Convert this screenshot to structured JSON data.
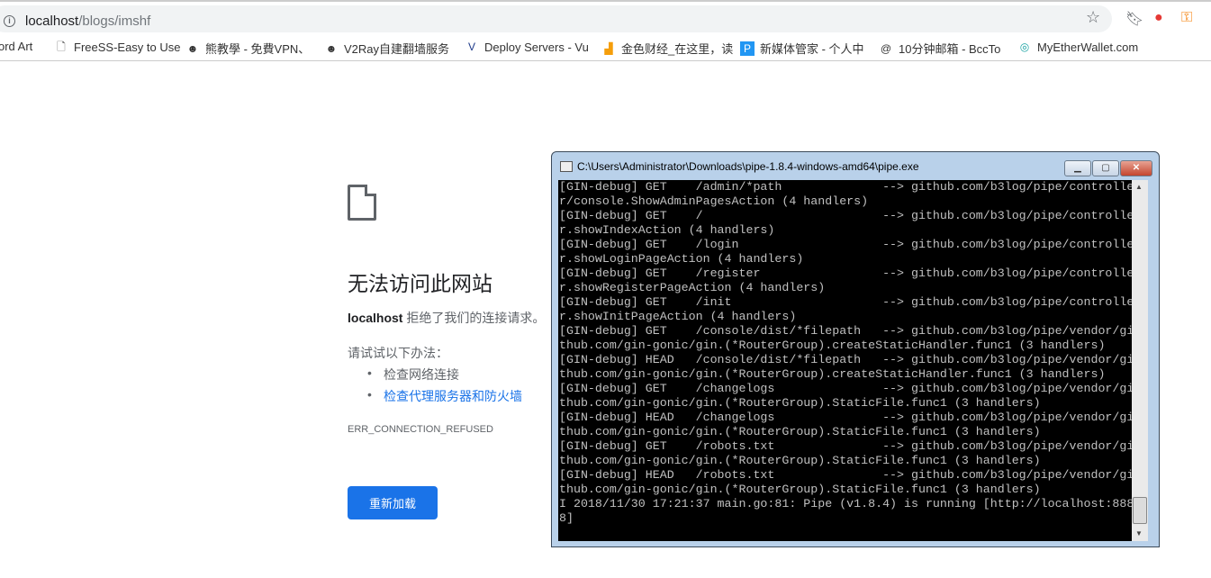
{
  "browser": {
    "url_host": "localhost",
    "url_path": "/blogs/imshf",
    "bookmarks": [
      {
        "label": "ord Art",
        "icon": ""
      },
      {
        "label": "FreeSS-Easy to Use",
        "icon": "page-icon"
      },
      {
        "label": "熊教學 - 免費VPN、",
        "icon": "avatar-icon"
      },
      {
        "label": "V2Ray自建翻墙服务",
        "icon": "avatar-icon"
      },
      {
        "label": "Deploy Servers - Vu",
        "icon": "vultr-icon"
      },
      {
        "label": "金色财经_在这里，读",
        "icon": "jinse-icon"
      },
      {
        "label": "新媒体管家 - 个人中",
        "icon": "p-icon"
      },
      {
        "label": "10分钟邮箱 - BccTo",
        "icon": "at-icon"
      },
      {
        "label": "MyEtherWallet.com",
        "icon": "mew-icon"
      }
    ]
  },
  "error_page": {
    "title": "无法访问此网站",
    "host": "localhost",
    "message": " 拒绝了我们的连接请求。",
    "try": "请试试以下办法：",
    "suggestions": [
      "检查网络连接",
      "检查代理服务器和防火墙"
    ],
    "code": "ERR_CONNECTION_REFUSED",
    "reload": "重新加载",
    "link_color": "#1a73e8"
  },
  "console": {
    "title": "C:\\Users\\Administrator\\Downloads\\pipe-1.8.4-windows-amd64\\pipe.exe",
    "lines": [
      "[GIN-debug] GET    /admin/*path              --> github.com/b3log/pipe/controlle",
      "r/console.ShowAdminPagesAction (4 handlers)",
      "[GIN-debug] GET    /                         --> github.com/b3log/pipe/controlle",
      "r.showIndexAction (4 handlers)",
      "[GIN-debug] GET    /login                    --> github.com/b3log/pipe/controlle",
      "r.showLoginPageAction (4 handlers)",
      "[GIN-debug] GET    /register                 --> github.com/b3log/pipe/controlle",
      "r.showRegisterPageAction (4 handlers)",
      "[GIN-debug] GET    /init                     --> github.com/b3log/pipe/controlle",
      "r.showInitPageAction (4 handlers)",
      "[GIN-debug] GET    /console/dist/*filepath   --> github.com/b3log/pipe/vendor/gi",
      "thub.com/gin-gonic/gin.(*RouterGroup).createStaticHandler.func1 (3 handlers)",
      "[GIN-debug] HEAD   /console/dist/*filepath   --> github.com/b3log/pipe/vendor/gi",
      "thub.com/gin-gonic/gin.(*RouterGroup).createStaticHandler.func1 (3 handlers)",
      "[GIN-debug] GET    /changelogs               --> github.com/b3log/pipe/vendor/gi",
      "thub.com/gin-gonic/gin.(*RouterGroup).StaticFile.func1 (3 handlers)",
      "[GIN-debug] HEAD   /changelogs               --> github.com/b3log/pipe/vendor/gi",
      "thub.com/gin-gonic/gin.(*RouterGroup).StaticFile.func1 (3 handlers)",
      "[GIN-debug] GET    /robots.txt               --> github.com/b3log/pipe/vendor/gi",
      "thub.com/gin-gonic/gin.(*RouterGroup).StaticFile.func1 (3 handlers)",
      "[GIN-debug] HEAD   /robots.txt               --> github.com/b3log/pipe/vendor/gi",
      "thub.com/gin-gonic/gin.(*RouterGroup).StaticFile.func1 (3 handlers)",
      "I 2018/11/30 17:21:37 main.go:81: Pipe (v1.8.4) is running [http://localhost:888",
      "8]"
    ]
  }
}
